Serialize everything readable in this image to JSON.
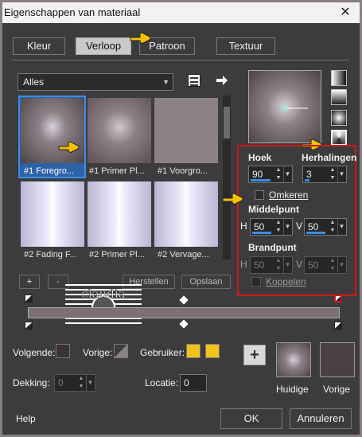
{
  "window": {
    "title": "Eigenschappen van materiaal",
    "close_glyph": "✕"
  },
  "tabs": [
    {
      "label": "Kleur",
      "active": false
    },
    {
      "label": "Verloop",
      "active": true
    },
    {
      "label": "Patroon",
      "active": false
    },
    {
      "label": "Textuur",
      "active": false
    }
  ],
  "category": {
    "value": "Alles"
  },
  "thumbnails": [
    {
      "caption": "#1 Foregro..."
    },
    {
      "caption": "#1 Primer Pl..."
    },
    {
      "caption": "#1 Voorgro..."
    },
    {
      "caption": "#2 Fading F..."
    },
    {
      "caption": "#2 Primer Pl..."
    },
    {
      "caption": "#2 Vervage..."
    }
  ],
  "library_buttons": {
    "add": "+",
    "remove": "-",
    "restore": "Herstellen",
    "save": "Opslaan"
  },
  "settings": {
    "angle_label": "Hoek",
    "angle_value": "90",
    "repeats_label": "Herhalingen",
    "repeats_value": "3",
    "invert_label": "Omkeren",
    "invert_checked": false,
    "center_label": "Middelpunt",
    "center_h_label": "H",
    "center_h": "50",
    "center_v_label": "V",
    "center_v": "50",
    "focal_label": "Brandpunt",
    "focal_h_label": "H",
    "focal_h": "50",
    "focal_v_label": "V",
    "focal_v": "50",
    "link_label": "Koppelen",
    "link_checked": false
  },
  "bottom": {
    "fg_label": "Volgende:",
    "bg_label": "Vorige:",
    "user_label": "Gebruiker:",
    "opacity_label": "Dekking:",
    "opacity_value": "0",
    "location_label": "Locatie:",
    "location_value": "0",
    "current_label": "Huidige",
    "previous_label": "Vorige",
    "help": "Help",
    "ok": "OK",
    "cancel": "Annuleren"
  },
  "watermark": {
    "text": "claudia"
  },
  "colors": {
    "accent": "#3a8ee6",
    "highlight_box": "#d01818",
    "user_swatch": "#f2c31a",
    "gradient_mid": "#8d8188",
    "gradient_dark": "#4a4347"
  }
}
